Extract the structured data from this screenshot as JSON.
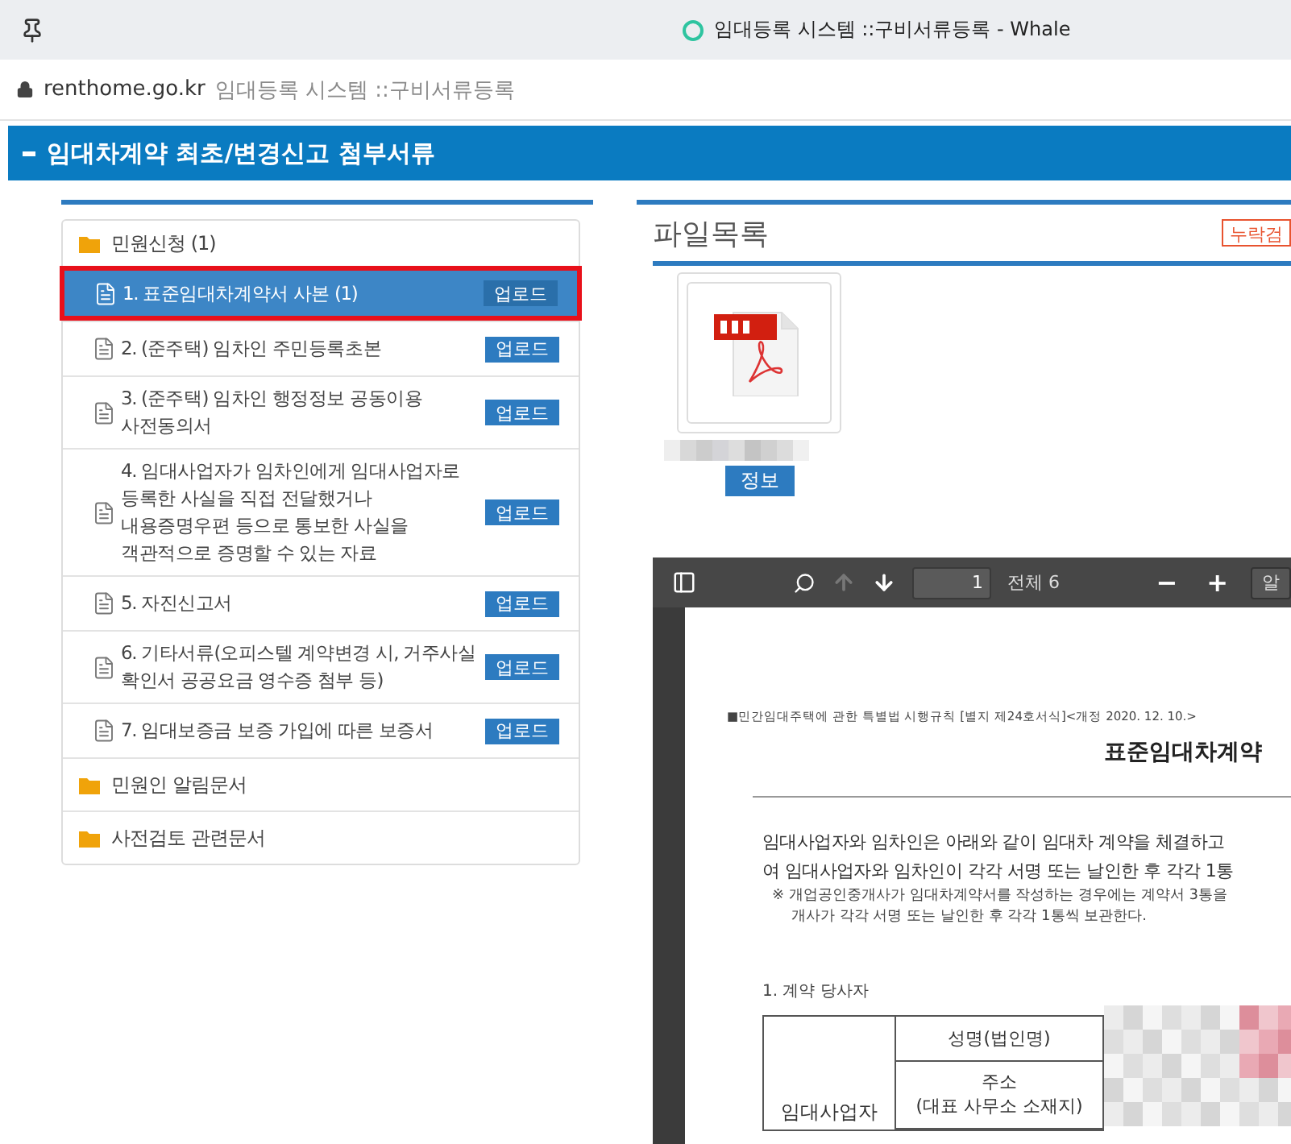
{
  "browser": {
    "title": "임대등록 시스템 ::구비서류등록 - Whale",
    "host": "renthome.go.kr",
    "page_title": "임대등록 시스템 ::구비서류등록"
  },
  "section": {
    "title": "임대차계약 최초/변경신고 첨부서류"
  },
  "tree": [
    {
      "label": "민원신청 (1)",
      "children": [
        {
          "label": "1. 표준임대차계약서 사본 (1)",
          "selected": true,
          "action": "업로드"
        },
        {
          "label": "2. (준주택) 임차인 주민등록초본",
          "selected": false,
          "action": "업로드"
        },
        {
          "label": "3. (준주택) 임차인 행정정보 공동이용 사전동의서",
          "selected": false,
          "action": "업로드"
        },
        {
          "label": "4. 임대사업자가 임차인에게 임대사업자로 등록한 사실을 직접 전달했거나 내용증명우편 등으로 통보한 사실을 객관적으로 증명할 수 있는 자료",
          "selected": false,
          "action": "업로드"
        },
        {
          "label": "5. 자진신고서",
          "selected": false,
          "action": "업로드"
        },
        {
          "label": "6. 기타서류(오피스텔 계약변경 시, 거주사실 확인서 공공요금 영수증 첨부 등)",
          "selected": false,
          "action": "업로드"
        },
        {
          "label": "7. 임대보증금 보증 가입에 따른 보증서",
          "selected": false,
          "action": "업로드"
        }
      ]
    },
    {
      "label": "민원인 알림문서"
    },
    {
      "label": "사전검토 관련문서"
    }
  ],
  "files": {
    "title": "파일목록",
    "review_button": "누락검",
    "items": [
      {
        "kind": "pdf",
        "action": "정보"
      }
    ]
  },
  "viewer": {
    "page": "1",
    "total": "전체 6",
    "zoom_out": "−",
    "zoom_in": "+",
    "scale": "알",
    "prev_page": {
      "disabled": true
    },
    "next_page": {
      "disabled": false
    }
  },
  "document": {
    "header": "■민간임대주택에 관한 특별법 시행규칙 [별지 제24호서식]<개정 2020. 12. 10.>",
    "title": "표준임대차계약",
    "intro": [
      "임대사업자와 임차인은 아래와 같이 임대차 계약을 체결하고",
      "여 임대사업자와 임차인이 각각 서명 또는 날인한 후 각각 1통"
    ],
    "note": [
      "※ 개업공인중개사가 임대차계약서를 작성하는 경우에는 계약서 3통을",
      "개사가 각각 서명 또는 날인한 후 각각 1통씩 보관한다."
    ],
    "section": "1. 계약 당사자",
    "table": {
      "party": "임대사업자",
      "fields": [
        [
          "성명(법인명)"
        ],
        [
          "주소",
          "(대표 사무소 소재지)"
        ]
      ]
    }
  }
}
